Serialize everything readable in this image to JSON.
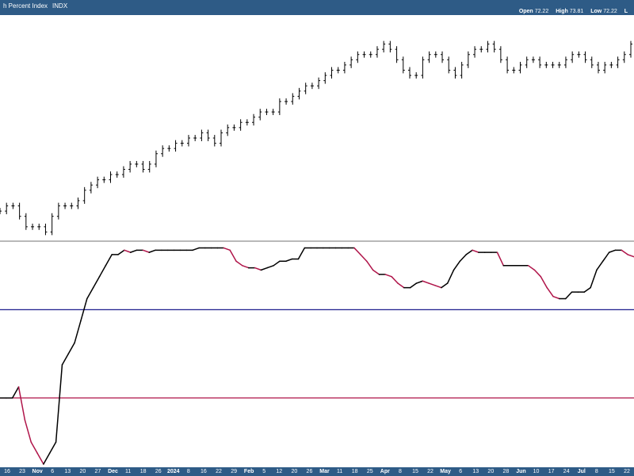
{
  "header": {
    "title": "h Percent Index",
    "ticker": "INDX",
    "ohlc": [
      {
        "label": "Open",
        "value": "72.22"
      },
      {
        "label": "High",
        "value": "73.81"
      },
      {
        "label": "Low",
        "value": "72.22"
      },
      {
        "label": "L",
        "value": ""
      }
    ]
  },
  "colors": {
    "header_bg": "#2e5b86",
    "price": "#000000",
    "indicator_rising": "#000000",
    "indicator_falling": "#b0154a",
    "upper_line": "#1a1a8c",
    "lower_line": "#b0154a"
  },
  "chart_data": [
    {
      "type": "ohlc",
      "panel": "price",
      "series": [
        {
          "values": [
            61,
            62,
            62,
            60,
            58,
            58,
            58,
            57,
            60,
            62,
            62,
            62,
            63,
            65,
            66,
            67,
            67,
            68,
            68,
            69,
            70,
            70,
            69,
            70,
            72,
            73,
            73,
            74,
            74,
            75,
            75,
            76,
            75,
            74,
            76,
            77,
            77,
            78,
            78,
            79,
            80,
            80,
            80,
            82,
            82,
            83,
            84,
            85,
            85,
            86,
            87,
            88,
            88,
            89,
            90,
            91,
            91,
            91,
            92,
            93,
            92,
            90,
            88,
            87,
            87,
            90,
            91,
            91,
            90,
            88,
            87,
            89,
            91,
            92,
            92,
            93,
            92,
            90,
            88,
            88,
            89,
            90,
            90,
            89,
            89,
            89,
            89,
            90,
            91,
            91,
            90,
            89,
            88,
            89,
            89,
            90,
            91,
            93
          ]
        }
      ]
    },
    {
      "type": "line",
      "panel": "indicator",
      "series": [
        {
          "values": [
            30,
            30,
            30,
            35,
            20,
            10,
            5,
            0,
            5,
            10,
            45,
            50,
            55,
            65,
            75,
            80,
            85,
            90,
            95,
            95,
            97,
            96,
            97,
            97,
            96,
            97,
            97,
            97,
            97,
            97,
            97,
            97,
            98,
            98,
            98,
            98,
            98,
            97,
            92,
            90,
            89,
            89,
            88,
            89,
            90,
            92,
            92,
            93,
            93,
            98,
            98,
            98,
            98,
            98,
            98,
            98,
            98,
            98,
            95,
            92,
            88,
            86,
            86,
            85,
            82,
            80,
            80,
            82,
            83,
            82,
            81,
            80,
            82,
            88,
            92,
            95,
            97,
            96,
            96,
            96,
            96,
            90,
            90,
            90,
            90,
            90,
            88,
            85,
            80,
            76,
            75,
            75,
            78,
            78,
            78,
            80,
            88,
            92,
            96,
            97,
            97,
            95,
            94
          ]
        }
      ],
      "hlines": [
        {
          "label": "upper",
          "value": 70
        },
        {
          "label": "lower",
          "value": 30
        }
      ]
    }
  ],
  "x_ticks": [
    {
      "label": "16",
      "month": false
    },
    {
      "label": "23",
      "month": false
    },
    {
      "label": "Nov",
      "month": true
    },
    {
      "label": "6",
      "month": false
    },
    {
      "label": "13",
      "month": false
    },
    {
      "label": "20",
      "month": false
    },
    {
      "label": "27",
      "month": false
    },
    {
      "label": "Dec",
      "month": true
    },
    {
      "label": "11",
      "month": false
    },
    {
      "label": "18",
      "month": false
    },
    {
      "label": "26",
      "month": false
    },
    {
      "label": "2024",
      "month": true
    },
    {
      "label": "8",
      "month": false
    },
    {
      "label": "16",
      "month": false
    },
    {
      "label": "22",
      "month": false
    },
    {
      "label": "29",
      "month": false
    },
    {
      "label": "Feb",
      "month": true
    },
    {
      "label": "5",
      "month": false
    },
    {
      "label": "12",
      "month": false
    },
    {
      "label": "20",
      "month": false
    },
    {
      "label": "26",
      "month": false
    },
    {
      "label": "Mar",
      "month": true
    },
    {
      "label": "11",
      "month": false
    },
    {
      "label": "18",
      "month": false
    },
    {
      "label": "25",
      "month": false
    },
    {
      "label": "Apr",
      "month": true
    },
    {
      "label": "8",
      "month": false
    },
    {
      "label": "15",
      "month": false
    },
    {
      "label": "22",
      "month": false
    },
    {
      "label": "May",
      "month": true
    },
    {
      "label": "6",
      "month": false
    },
    {
      "label": "13",
      "month": false
    },
    {
      "label": "20",
      "month": false
    },
    {
      "label": "28",
      "month": false
    },
    {
      "label": "Jun",
      "month": true
    },
    {
      "label": "10",
      "month": false
    },
    {
      "label": "17",
      "month": false
    },
    {
      "label": "24",
      "month": false
    },
    {
      "label": "Jul",
      "month": true
    },
    {
      "label": "8",
      "month": false
    },
    {
      "label": "15",
      "month": false
    },
    {
      "label": "22",
      "month": false
    }
  ]
}
